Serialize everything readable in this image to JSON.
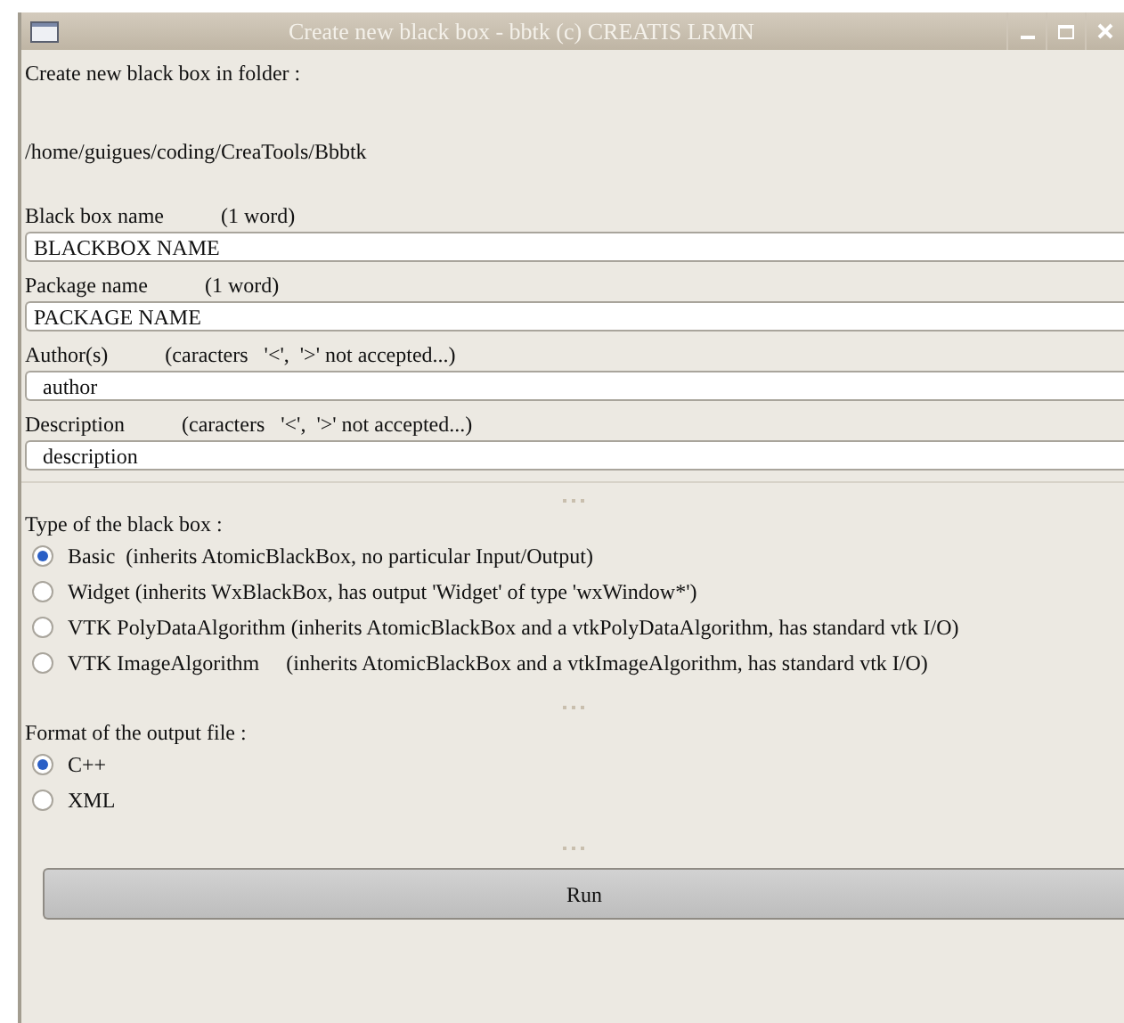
{
  "window": {
    "title": "Create new black box - bbtk (c) CREATIS LRMN"
  },
  "folder_prompt": "Create new black box in folder :",
  "folder_path": "/home/guigues/coding/CreaTools/Bbbtk",
  "fields": [
    {
      "label": "Black box name",
      "hint": "(1 word)",
      "value": "BLACKBOX NAME"
    },
    {
      "label": "Package name",
      "hint": "(1 word)",
      "value": "PACKAGE NAME"
    },
    {
      "label": "Author(s)",
      "hint": "(caracters   '<',  '>' not accepted...)",
      "value": "author"
    },
    {
      "label": "Description",
      "hint": "(caracters   '<',  '>' not accepted...)",
      "value": "description"
    }
  ],
  "type_group": {
    "title": "Type of the black box :",
    "options": [
      {
        "label": "Basic  (inherits AtomicBlackBox, no particular Input/Output)",
        "selected": true
      },
      {
        "label": "Widget (inherits WxBlackBox, has output 'Widget' of type 'wxWindow*')",
        "selected": false
      },
      {
        "label": "VTK PolyDataAlgorithm (inherits AtomicBlackBox and a vtkPolyDataAlgorithm, has standard vtk I/O)",
        "selected": false
      },
      {
        "label": "VTK ImageAlgorithm     (inherits AtomicBlackBox and a vtkImageAlgorithm, has standard vtk I/O)",
        "selected": false
      }
    ]
  },
  "format_group": {
    "title": "Format of the output file :",
    "options": [
      {
        "label": "C++",
        "selected": true
      },
      {
        "label": "XML",
        "selected": false
      }
    ]
  },
  "run_button": "Run"
}
